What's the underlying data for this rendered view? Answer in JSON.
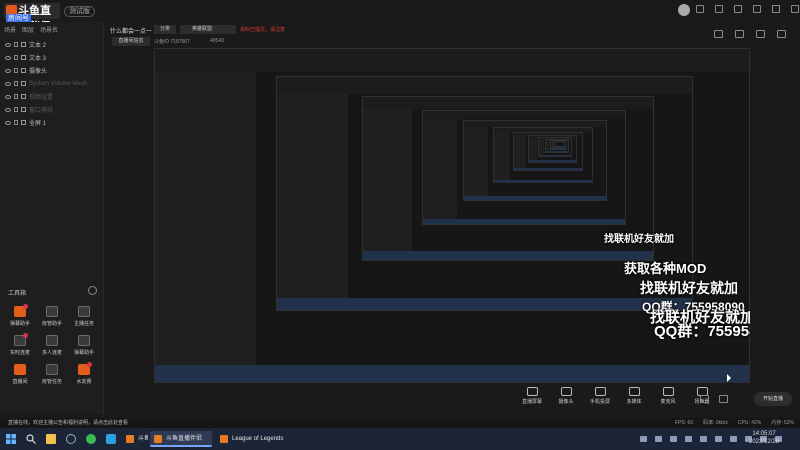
{
  "app": {
    "logo_text": "斗鱼直播伴侣",
    "version_badge": "测试版",
    "room_badge": "房间号",
    "room_id": "7187567",
    "accent": "#e55a1c"
  },
  "left_panel": {
    "tabs": [
      "场景",
      "图层",
      "场景名"
    ],
    "scenes": [
      {
        "label": "文本 2",
        "dim": false
      },
      {
        "label": "文本 3",
        "dim": false
      },
      {
        "label": "摄像头",
        "dim": false
      },
      {
        "label": "System Volume Mesh",
        "dim": true
      },
      {
        "label": "视频设置",
        "dim": true
      },
      {
        "label": "窗口捕获",
        "dim": true
      },
      {
        "label": "全屏 1",
        "dim": false
      }
    ],
    "tool_title": "工具箱",
    "tools": [
      {
        "label": "弹幕助手",
        "icon": "danmu-icon",
        "orange": true,
        "badge": true
      },
      {
        "label": "房管助手",
        "icon": "admin-icon",
        "orange": false,
        "badge": false
      },
      {
        "label": "主播任务",
        "icon": "task-icon",
        "orange": false,
        "badge": false
      },
      {
        "label": "实时连麦",
        "icon": "mic-link-icon",
        "orange": false,
        "badge": true
      },
      {
        "label": "多人连麦",
        "icon": "multi-mic-icon",
        "orange": false,
        "badge": false
      },
      {
        "label": "弹幕助手",
        "icon": "danmu2-icon",
        "orange": false,
        "badge": false
      },
      {
        "label": "直播间",
        "icon": "room-icon",
        "orange": true,
        "badge": false
      },
      {
        "label": "房管任务",
        "icon": "admin-task-icon",
        "orange": false,
        "badge": false
      },
      {
        "label": "水友赛",
        "icon": "match-icon",
        "orange": true,
        "badge": true
      }
    ]
  },
  "header": {
    "title": "什么都会一点一",
    "category": "分类",
    "game": "英雄联盟",
    "warning": "资料已提交，请注意",
    "edit_button": "直播间信息",
    "room_label": "斗鱼ID 7187567",
    "viewers": "49543"
  },
  "ads": {
    "line1": "找联机好友就加",
    "line2": "QQ群：755958090",
    "line3": "获取各种MOD"
  },
  "bottom_toolbar": [
    "直播屏幕",
    "摄像头",
    "手机投屏",
    "多媒体",
    "麦克风",
    "扬声器"
  ],
  "go_live": "开始直播",
  "status": {
    "message": "直播在线，欢迎主播公告和福利说明，请点击此处查看",
    "fps": "FPS: 60",
    "bitrate": "码率: 0kb/s",
    "cpu": "CPU: 42%",
    "mem": "内存: 52%"
  },
  "taskbar": {
    "apps": [
      {
        "label": "斗鱼直播伴侣",
        "active": false
      },
      {
        "label": "斗鱼直播伴侣",
        "active": true
      },
      {
        "label": "League of Legends",
        "active": false
      }
    ],
    "time": "14:05:07",
    "date": "2022/12/28"
  }
}
